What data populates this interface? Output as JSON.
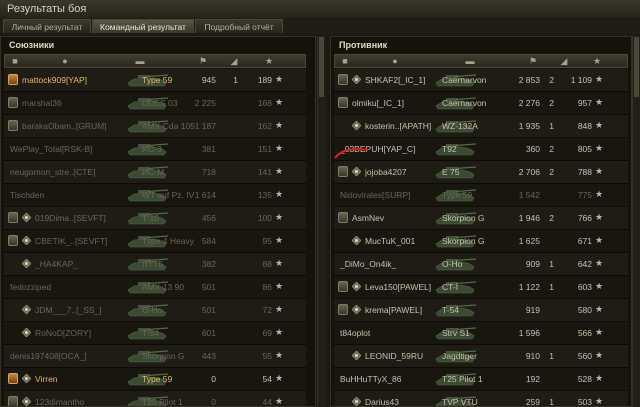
{
  "window": {
    "title": "Результаты боя"
  },
  "tabs": [
    {
      "label": "Личный результат",
      "active": false
    },
    {
      "label": "Командный результат",
      "active": true
    },
    {
      "label": "Подробный отчёт",
      "active": false
    }
  ],
  "allies": {
    "title": "Союзники",
    "rows": [
      {
        "badge": "gold",
        "platoon": false,
        "name": "mattock909[YAP]",
        "tank": "Type 59",
        "damage": "945",
        "kills": "1",
        "xp": "189",
        "dead": false,
        "self": true
      },
      {
        "badge": "normal",
        "platoon": false,
        "name": "marshal36",
        "tank": "UDES 03",
        "damage": "2 225",
        "kills": "",
        "xp": "168",
        "dead": true,
        "self": false
      },
      {
        "badge": "normal",
        "platoon": false,
        "name": "barakaObam..[GRUM]",
        "tank": "AMX Cda 105",
        "damage": "1 187",
        "kills": "",
        "xp": "162",
        "dead": true,
        "self": false
      },
      {
        "badge": "none",
        "platoon": false,
        "name": "WePlay_Total[RSK-B]",
        "tank": "ИС-3",
        "damage": "381",
        "kills": "",
        "xp": "151",
        "dead": true,
        "self": false
      },
      {
        "badge": "none",
        "platoon": false,
        "name": "neugomon_stre..[CTE]",
        "tank": "ИС-М",
        "damage": "718",
        "kills": "",
        "xp": "141",
        "dead": true,
        "self": false
      },
      {
        "badge": "none",
        "platoon": false,
        "name": "Tischden",
        "tank": "WT auf Pz. IV",
        "damage": "1 614",
        "kills": "",
        "xp": "135",
        "dead": true,
        "self": false
      },
      {
        "badge": "normal",
        "platoon": true,
        "name": "019Dima..[SEVFT]",
        "tank": "T-10",
        "damage": "456",
        "kills": "",
        "xp": "100",
        "dead": true,
        "self": false
      },
      {
        "badge": "normal",
        "platoon": true,
        "name": "CBETIK_..[SEVFT]",
        "tank": "Type 4 Heavy",
        "damage": "584",
        "kills": "",
        "xp": "95",
        "dead": true,
        "self": false
      },
      {
        "badge": "none",
        "platoon": true,
        "name": "_HA4KAP_",
        "tank": "ЛТТБ",
        "damage": "382",
        "kills": "",
        "xp": "88",
        "dead": true,
        "self": false
      },
      {
        "badge": "none",
        "platoon": false,
        "name": "fedozziped",
        "tank": "AMX 13 90",
        "damage": "501",
        "kills": "",
        "xp": "86",
        "dead": true,
        "self": false
      },
      {
        "badge": "none",
        "platoon": true,
        "name": "JDM___7..[_SS_]",
        "tank": "O-Ho",
        "damage": "501",
        "kills": "",
        "xp": "72",
        "dead": true,
        "self": false
      },
      {
        "badge": "none",
        "platoon": true,
        "name": "RoNoD[ZORY]",
        "tank": "T-54",
        "damage": "601",
        "kills": "",
        "xp": "69",
        "dead": true,
        "self": false
      },
      {
        "badge": "none",
        "platoon": false,
        "name": "denis197408[OCA_]",
        "tank": "Skorpion G",
        "damage": "443",
        "kills": "",
        "xp": "55",
        "dead": true,
        "self": false
      },
      {
        "badge": "gold",
        "platoon": true,
        "name": "Virren",
        "tank": "Type 59",
        "damage": "0",
        "kills": "",
        "xp": "54",
        "dead": true,
        "self": true
      },
      {
        "badge": "normal",
        "platoon": true,
        "name": "123dimantho",
        "tank": "T25 Pilot 1",
        "damage": "0",
        "kills": "",
        "xp": "44",
        "dead": true,
        "self": false
      }
    ]
  },
  "enemies": {
    "title": "Противник",
    "rows": [
      {
        "badge": "normal",
        "platoon": true,
        "name": "SHKAF2[_IC_1]",
        "tank": "Caernarvon",
        "damage": "2 853",
        "kills": "2",
        "xp": "1 109",
        "dead": false
      },
      {
        "badge": "normal",
        "platoon": false,
        "name": "olmiku[_IC_1]",
        "tank": "Caernarvon",
        "damage": "2 276",
        "kills": "2",
        "xp": "957",
        "dead": false
      },
      {
        "badge": "none",
        "platoon": true,
        "name": "kosterin..[APATH]",
        "tank": "WZ-132A",
        "damage": "1 935",
        "kills": "1",
        "xp": "848",
        "dead": false
      },
      {
        "badge": "none",
        "platoon": false,
        "name": "_03BEPUH[YAP_C]",
        "tank": "T92",
        "damage": "360",
        "kills": "2",
        "xp": "805",
        "dead": false
      },
      {
        "badge": "normal",
        "platoon": true,
        "name": "jojoba4207",
        "tank": "E 75",
        "damage": "2 706",
        "kills": "2",
        "xp": "788",
        "dead": false
      },
      {
        "badge": "none",
        "platoon": false,
        "name": "Nidovirales[SURP]",
        "tank": "Type 59",
        "damage": "1 542",
        "kills": "",
        "xp": "775",
        "dead": true
      },
      {
        "badge": "normal",
        "platoon": false,
        "name": "AsmNev",
        "tank": "Skorpion G",
        "damage": "1 946",
        "kills": "2",
        "xp": "766",
        "dead": false
      },
      {
        "badge": "none",
        "platoon": true,
        "name": "MucTuK_001",
        "tank": "Skorpion G",
        "damage": "1 625",
        "kills": "",
        "xp": "671",
        "dead": false
      },
      {
        "badge": "none",
        "platoon": false,
        "name": "_DiMo_On4ik_",
        "tank": "O-Ho",
        "damage": "909",
        "kills": "1",
        "xp": "642",
        "dead": false
      },
      {
        "badge": "normal",
        "platoon": true,
        "name": "Leva150[PAWEL]",
        "tank": "CT-I",
        "damage": "1 122",
        "kills": "1",
        "xp": "603",
        "dead": false
      },
      {
        "badge": "normal",
        "platoon": true,
        "name": "krema[PAWEL]",
        "tank": "T-54",
        "damage": "919",
        "kills": "",
        "xp": "580",
        "dead": false
      },
      {
        "badge": "none",
        "platoon": false,
        "name": "t84oplot",
        "tank": "Strv S1",
        "damage": "1 596",
        "kills": "",
        "xp": "566",
        "dead": false
      },
      {
        "badge": "none",
        "platoon": true,
        "name": "LEONID_59RU",
        "tank": "Jagdtiger",
        "damage": "910",
        "kills": "1",
        "xp": "560",
        "dead": false
      },
      {
        "badge": "none",
        "platoon": false,
        "name": "BuHHuTTyX_86",
        "tank": "T25 Pilot 1",
        "damage": "192",
        "kills": "",
        "xp": "528",
        "dead": false
      },
      {
        "badge": "none",
        "platoon": true,
        "name": "Darius43",
        "tank": "TVP VTU",
        "damage": "259",
        "kills": "1",
        "xp": "503",
        "dead": false
      }
    ]
  },
  "header_icons": [
    "badge-icon",
    "player-icon",
    "vehicle-icon",
    "damage-icon",
    "kills-icon",
    "xp-star-icon"
  ],
  "colors": {
    "self": "#e9b86a",
    "dead": "#6b6656",
    "alive": "#c9c2ad",
    "annotation": "#d8201c"
  }
}
